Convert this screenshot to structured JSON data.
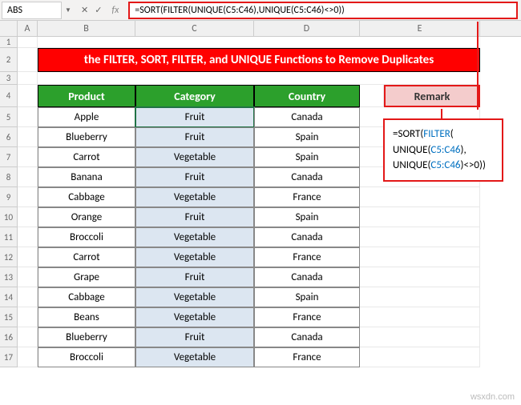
{
  "nameBox": "ABS",
  "formulaBar": "=SORT(FILTER(UNIQUE(C5:C46),UNIQUE(C5:C46)<>0))",
  "fxSymbols": {
    "cancel": "✕",
    "check": "✓",
    "fx": "fx"
  },
  "columns": [
    "A",
    "B",
    "C",
    "D",
    "E"
  ],
  "titleBanner": "the FILTER, SORT, FILTER, and UNIQUE Functions to Remove Duplicates",
  "headers": {
    "product": "Product",
    "category": "Category",
    "country": "Country",
    "remark": "Remark"
  },
  "rows": [
    {
      "n": 5,
      "product": "Apple",
      "category": "Fruit",
      "country": "Canada"
    },
    {
      "n": 6,
      "product": "Blueberry",
      "category": "Fruit",
      "country": "Spain"
    },
    {
      "n": 7,
      "product": "Carrot",
      "category": "Vegetable",
      "country": "Spain"
    },
    {
      "n": 8,
      "product": "Banana",
      "category": "Fruit",
      "country": "Canada"
    },
    {
      "n": 9,
      "product": "Cabbage",
      "category": "Vegetable",
      "country": "France"
    },
    {
      "n": 10,
      "product": "Orange",
      "category": "Fruit",
      "country": "Spain"
    },
    {
      "n": 11,
      "product": "Broccoli",
      "category": "Vegetable",
      "country": "Canada"
    },
    {
      "n": 12,
      "product": "Carrot",
      "category": "Vegetable",
      "country": "France"
    },
    {
      "n": 13,
      "product": "Grape",
      "category": "Fruit",
      "country": "Canada"
    },
    {
      "n": 14,
      "product": "Cabbage",
      "category": "Vegetable",
      "country": "Spain"
    },
    {
      "n": 15,
      "product": "Beans",
      "category": "Vegetable",
      "country": "France"
    },
    {
      "n": 16,
      "product": "Blueberry",
      "category": "Fruit",
      "country": "Canada"
    },
    {
      "n": 17,
      "product": "Broccoli",
      "category": "Vegetable",
      "country": "France"
    }
  ],
  "remark": {
    "line1a": "=SORT(",
    "line1b": "FILTER",
    "line1c": "(",
    "line2a": "UNIQUE",
    "line2b": "(",
    "line2c": "C5:C46",
    "line2d": "),",
    "line3a": "UNIQUE",
    "line3b": "(",
    "line3c": "C5:C46",
    "line3d": ")<>0))"
  },
  "watermark": "wsxdn.com"
}
